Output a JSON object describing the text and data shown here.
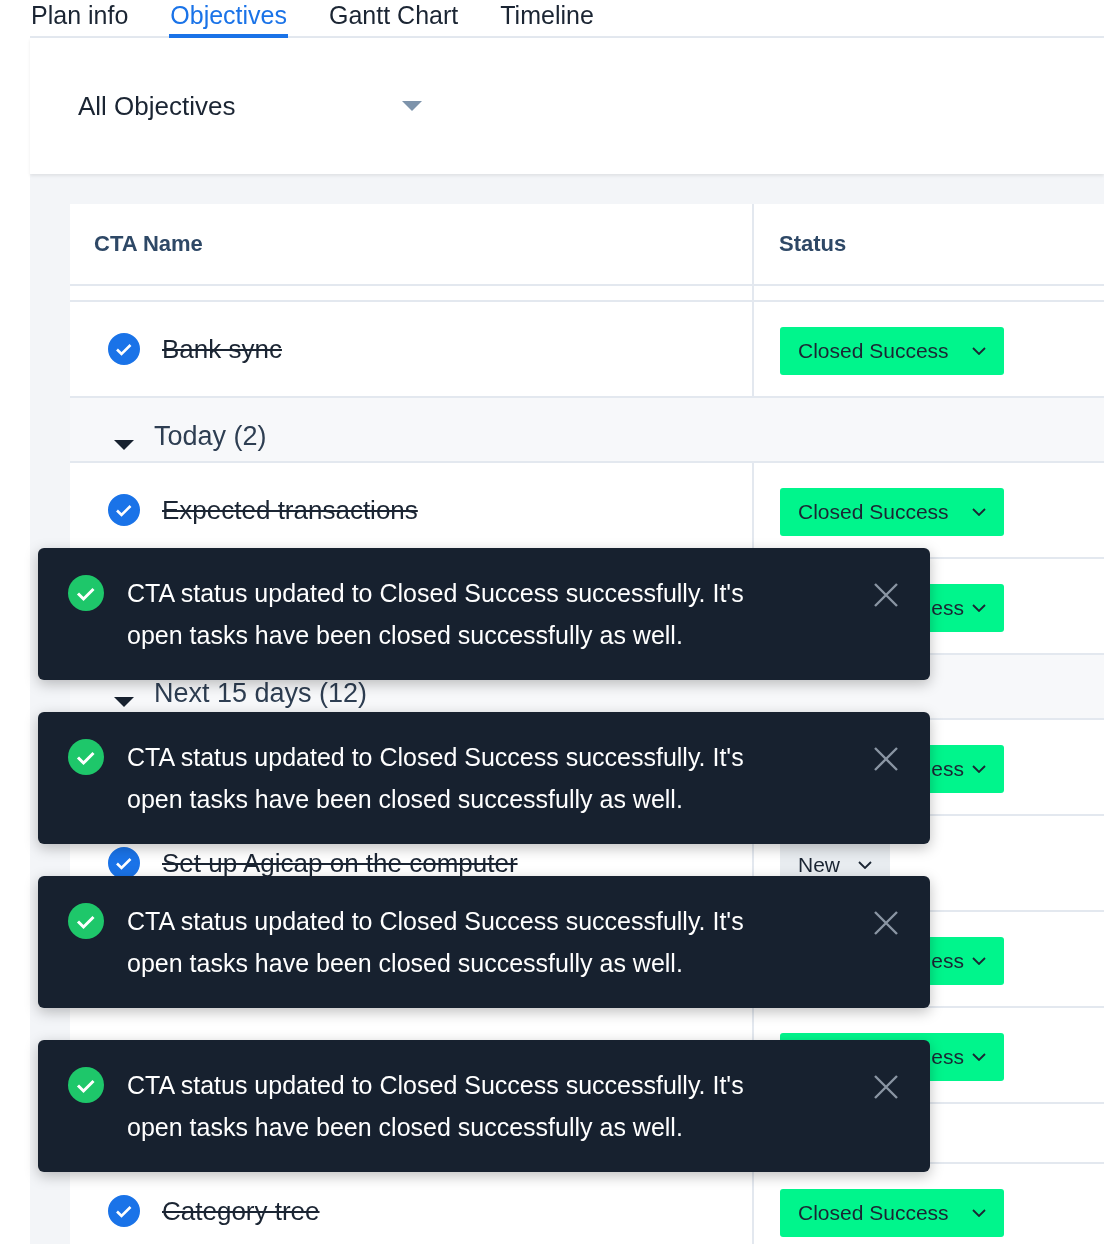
{
  "tabs": [
    {
      "label": "Plan info",
      "selected": false
    },
    {
      "label": "Objectives",
      "selected": true
    },
    {
      "label": "Gantt Chart",
      "selected": false
    },
    {
      "label": "Timeline",
      "selected": false
    }
  ],
  "filter": {
    "value": "All Objectives"
  },
  "table": {
    "columns": [
      "CTA Name",
      "Status"
    ],
    "rows": [
      {
        "kind": "task",
        "name": "Bank sync",
        "done": true,
        "status": {
          "label": "Closed Success",
          "kind": "success"
        }
      },
      {
        "kind": "group",
        "label": "Today (2)",
        "expanded": true
      },
      {
        "kind": "task",
        "name": "Expected transactions",
        "done": true,
        "status": {
          "label": "Closed Success",
          "kind": "success"
        }
      },
      {
        "kind": "task",
        "status": {
          "label": "ess",
          "kind": "success"
        }
      },
      {
        "kind": "group",
        "label": "Next 15 days (12)",
        "expanded": true
      },
      {
        "kind": "task",
        "status": {
          "label": "ess",
          "kind": "success"
        }
      },
      {
        "kind": "task",
        "name": "Set up Agicap on the computer",
        "done": true,
        "status": {
          "label": "New",
          "kind": "new"
        }
      },
      {
        "kind": "task",
        "status": {
          "label": "ess",
          "kind": "success"
        }
      },
      {
        "kind": "task",
        "status": {
          "label": "ess",
          "kind": "success"
        }
      },
      {
        "kind": "task"
      },
      {
        "kind": "task",
        "name": "Category tree",
        "done": true,
        "status": {
          "label": "Closed Success",
          "kind": "success"
        }
      }
    ]
  },
  "toasts": [
    {
      "message": "CTA status updated to Closed Success successfully. It's open tasks have been closed successfully as well."
    },
    {
      "message": "CTA status updated to Closed Success successfully. It's open tasks have been closed successfully as well."
    },
    {
      "message": "CTA status updated to Closed Success successfully. It's open tasks have been closed successfully as well."
    },
    {
      "message": "CTA status updated to Closed Success successfully. It's open tasks have been closed successfully as well."
    }
  ]
}
